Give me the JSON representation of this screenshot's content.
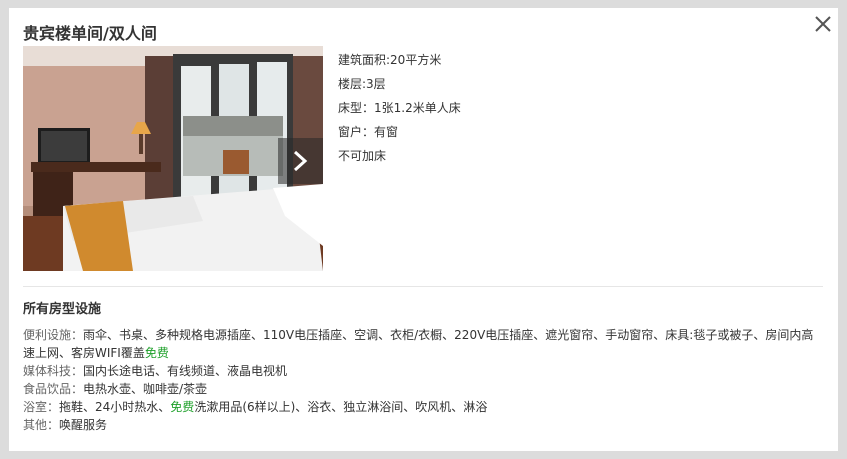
{
  "dialog": {
    "title": "贵宾楼单间/双人间"
  },
  "icons": {
    "close": "close-icon",
    "next": "chevron-right-icon"
  },
  "room_info": {
    "area": "建筑面积:20平方米",
    "floor": "楼层:3层",
    "bed": "床型：1张1.2米单人床",
    "window": "窗户：有窗",
    "extra_bed": "不可加床"
  },
  "facilities": {
    "heading": "所有房型设施",
    "convenience": {
      "label": "便利设施：",
      "text": "雨伞、书桌、多种规格电源插座、110V电压插座、空调、衣柜/衣橱、220V电压插座、遮光窗帘、手动窗帘、床具:毯子或被子、房间内高速上网、客房WIFI覆盖",
      "free": "免费"
    },
    "media": {
      "label": "媒体科技：",
      "text": "国内长途电话、有线频道、液晶电视机"
    },
    "food": {
      "label": "食品饮品：",
      "text": "电热水壶、咖啡壶/茶壶"
    },
    "bath": {
      "label": "浴室：",
      "text_before": "拖鞋、24小时热水、",
      "free": "免费",
      "text_after": "洗漱用品(6样以上)、浴衣、独立淋浴间、吹风机、淋浴"
    },
    "other": {
      "label": "其他：",
      "text": "唤醒服务"
    }
  },
  "colors": {
    "free_text": "#1ea02a",
    "backdrop": "#dcdcdc"
  }
}
